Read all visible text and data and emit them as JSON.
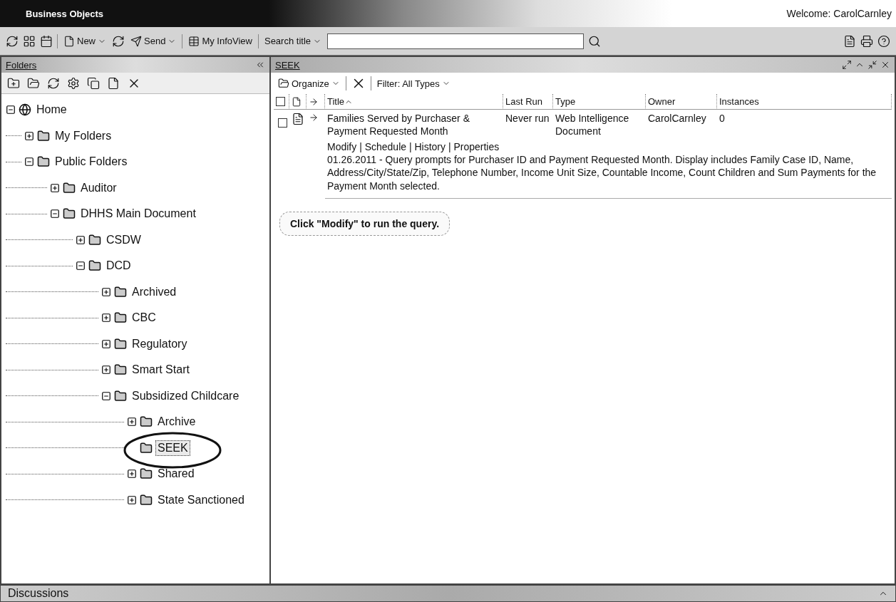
{
  "header": {
    "logo": "Business Objects",
    "welcome": "Welcome: CarolCarnley"
  },
  "toolbar": {
    "new": "New",
    "send": "Send",
    "my_infoview": "My InfoView",
    "search_label": "Search title"
  },
  "folders_panel": {
    "title": "Folders",
    "tree": [
      {
        "label": "Home",
        "kind": "home",
        "expanded": true,
        "selected": false,
        "children": [
          {
            "label": "My Folders",
            "kind": "folder",
            "expanded": false,
            "selected": false
          },
          {
            "label": "Public Folders",
            "kind": "folder",
            "expanded": true,
            "selected": false,
            "children": [
              {
                "label": "Auditor",
                "kind": "folder",
                "expanded": false,
                "selected": false
              },
              {
                "label": "DHHS Main Document",
                "kind": "folder",
                "expanded": true,
                "selected": false,
                "children": [
                  {
                    "label": "CSDW",
                    "kind": "folder",
                    "expanded": false,
                    "selected": false
                  },
                  {
                    "label": "DCD",
                    "kind": "folder",
                    "expanded": true,
                    "selected": false,
                    "children": [
                      {
                        "label": "Archived",
                        "kind": "folder",
                        "expanded": false,
                        "selected": false
                      },
                      {
                        "label": "CBC",
                        "kind": "folder",
                        "expanded": false,
                        "selected": false
                      },
                      {
                        "label": "Regulatory",
                        "kind": "folder",
                        "expanded": false,
                        "selected": false
                      },
                      {
                        "label": "Smart Start",
                        "kind": "folder",
                        "expanded": false,
                        "selected": false
                      },
                      {
                        "label": "Subsidized Childcare",
                        "kind": "folder",
                        "expanded": true,
                        "selected": false,
                        "children": [
                          {
                            "label": "Archive",
                            "kind": "folder",
                            "expanded": false,
                            "selected": false
                          },
                          {
                            "label": "SEEK",
                            "kind": "folder",
                            "selected": true
                          },
                          {
                            "label": "Shared",
                            "kind": "folder",
                            "expanded": false,
                            "selected": false
                          },
                          {
                            "label": "State Sanctioned",
                            "kind": "folder",
                            "expanded": false,
                            "selected": false
                          }
                        ]
                      }
                    ]
                  }
                ]
              }
            ]
          }
        ]
      }
    ]
  },
  "content_panel": {
    "title": "SEEK",
    "organize": "Organize",
    "filter_label": "Filter:",
    "filter_value": "All Types",
    "select_all_checked": false,
    "columns": [
      "Title",
      "Last Run",
      "Type",
      "Owner",
      "Instances"
    ],
    "rows": [
      {
        "checked": false,
        "title": "Families Served by Purchaser & Payment Requested Month",
        "last_run": "Never run",
        "type": "Web Intelligence Document",
        "owner": "CarolCarnley",
        "instances": "0",
        "actions": [
          "Modify",
          "Schedule",
          "History",
          "Properties"
        ],
        "action_separator": "|",
        "description": "01.26.2011 - Query prompts for Purchaser ID and Payment Requested Month. Display includes Family Case ID, Name, Address/City/State/Zip, Telephone Number, Income Unit Size, Countable Income, Count Children and Sum Payments for the Payment Month selected."
      }
    ],
    "callout": "Click \"Modify\" to run the query."
  },
  "discussions": {
    "title": "Discussions"
  }
}
